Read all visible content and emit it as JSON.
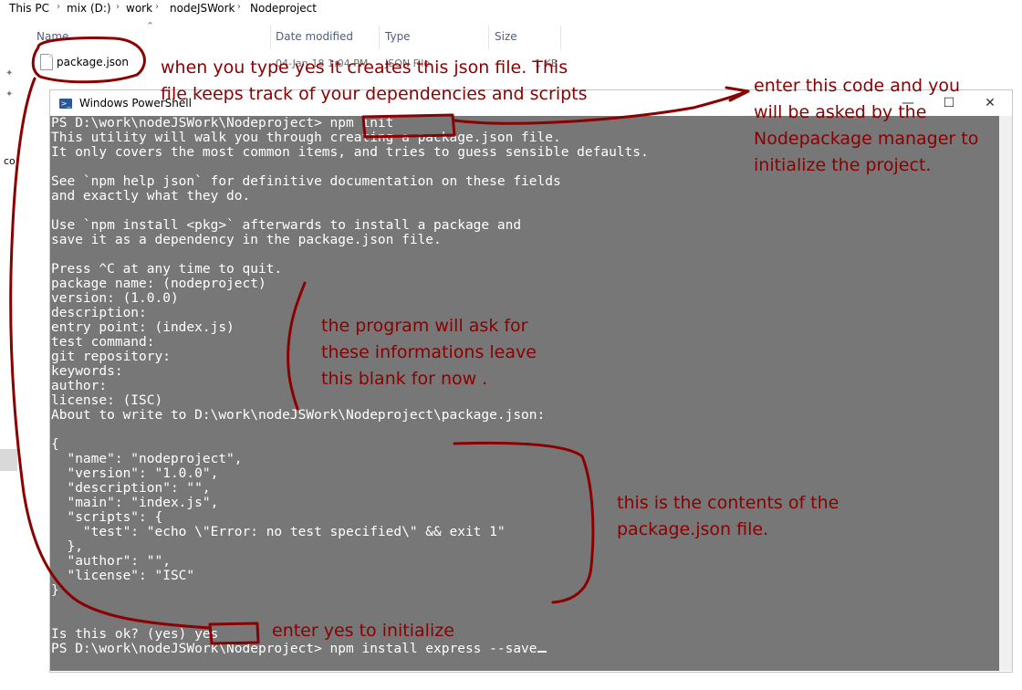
{
  "explorer": {
    "breadcrumb": [
      "This PC",
      "mix (D:)",
      "work",
      "nodeJSWork",
      "Nodeproject"
    ],
    "columns": {
      "name": "Name",
      "date": "Date modified",
      "type": "Type",
      "size": "Size"
    },
    "file": {
      "name": "package.json",
      "date": "04-Jan-18 1:04 PM",
      "type": "JSON File",
      "size": "1 KB"
    },
    "side_text": "co"
  },
  "powershell": {
    "title": "Windows PowerShell",
    "buttons": {
      "minimize": "—",
      "maximize": "☐",
      "close": "✕"
    },
    "lines": [
      "PS D:\\work\\nodeJSWork\\Nodeproject> npm init",
      "This utility will walk you through creating a package.json file.",
      "It only covers the most common items, and tries to guess sensible defaults.",
      "",
      "See `npm help json` for definitive documentation on these fields",
      "and exactly what they do.",
      "",
      "Use `npm install <pkg>` afterwards to install a package and",
      "save it as a dependency in the package.json file.",
      "",
      "Press ^C at any time to quit.",
      "package name: (nodeproject)",
      "version: (1.0.0)",
      "description:",
      "entry point: (index.js)",
      "test command:",
      "git repository:",
      "keywords:",
      "author:",
      "license: (ISC)",
      "About to write to D:\\work\\nodeJSWork\\Nodeproject\\package.json:",
      "",
      "{",
      "  \"name\": \"nodeproject\",",
      "  \"version\": \"1.0.0\",",
      "  \"description\": \"\",",
      "  \"main\": \"index.js\",",
      "  \"scripts\": {",
      "    \"test\": \"echo \\\"Error: no test specified\\\" && exit 1\"",
      "  },",
      "  \"author\": \"\",",
      "  \"license\": \"ISC\"",
      "}",
      "",
      "",
      "Is this ok? (yes) yes",
      "PS D:\\work\\nodeJSWork\\Nodeproject> npm install express --save"
    ]
  },
  "annotations": {
    "json_file_note": [
      "when you type yes it creates this json file. This",
      "file keeps track of your dependencies and scripts"
    ],
    "npm_init_note": [
      "enter this code and you",
      "will be asked by the",
      "Nodepackage manager to",
      "initialize the project."
    ],
    "fields_note": [
      "the program will ask for",
      "these informations leave",
      "this blank for now ."
    ],
    "contents_note": [
      "this is the contents of the",
      "package.json file."
    ],
    "yes_note": "enter yes to initialize"
  },
  "colors": {
    "console_bg": "#777777",
    "console_text": "#ffffff",
    "annotation": "#8b0000"
  }
}
